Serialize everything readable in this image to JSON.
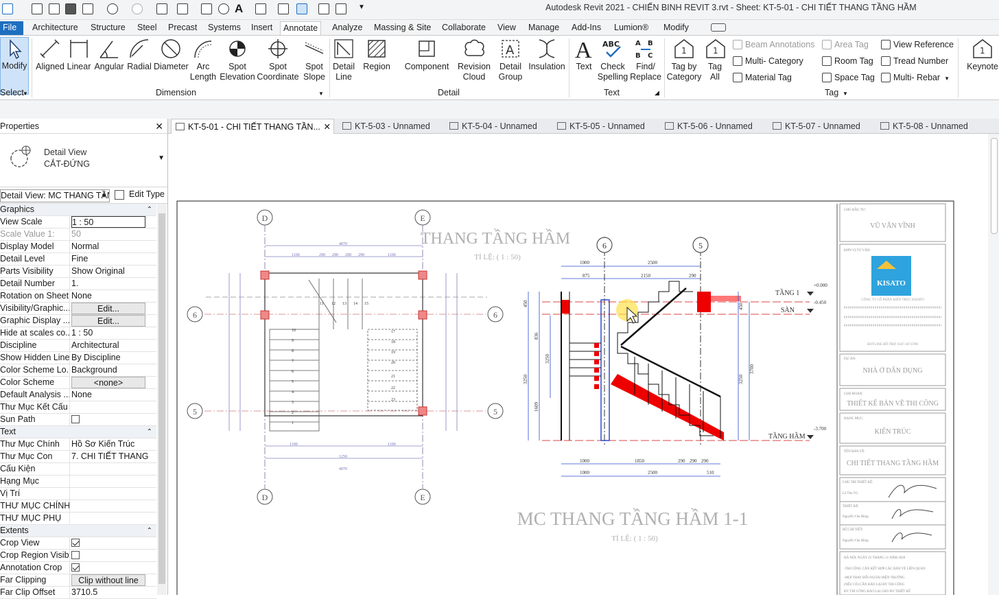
{
  "window": {
    "title": "Autodesk Revit 2021 - CHIẾN BINH REVIT 3.rvt - Sheet: KT-5-01 - CHI TIẾT THANG TẦNG HẦM"
  },
  "ribbon_tabs": [
    "File",
    "Architecture",
    "Structure",
    "Steel",
    "Precast",
    "Systems",
    "Insert",
    "Annotate",
    "Analyze",
    "Massing & Site",
    "Collaborate",
    "View",
    "Manage",
    "Add-Ins",
    "Lumion®",
    "Modify"
  ],
  "ribbon": {
    "modify": "Modify",
    "select": "Select",
    "dimension": {
      "label": "Dimension",
      "aligned": "Aligned",
      "linear": "Linear",
      "angular": "Angular",
      "radial": "Radial",
      "diameter": "Diameter",
      "arc1": "Arc",
      "arc2": "Length",
      "se1": "Spot",
      "se2": "Elevation",
      "sc1": "Spot",
      "sc2": "Coordinate",
      "ss1": "Spot",
      "ss2": "Slope"
    },
    "detail": {
      "label": "Detail",
      "dl1": "Detail",
      "dl2": "Line",
      "region": "Region",
      "component": "Component",
      "rc1": "Revision",
      "rc2": "Cloud",
      "dg1": "Detail",
      "dg2": "Group",
      "insulation": "Insulation"
    },
    "text": {
      "label": "Text",
      "text": "Text",
      "cs1": "Check",
      "cs2": "Spelling",
      "fr1": "Find/",
      "fr2": "Replace"
    },
    "tag": {
      "label": "Tag",
      "tc1": "Tag by",
      "tc2": "Category",
      "ta1": "Tag",
      "ta2": "All",
      "beam": "Beam Annotations",
      "multi_cat": "Multi- Category",
      "material": "Material Tag",
      "area": "Area Tag",
      "room": "Room Tag",
      "space": "Space Tag",
      "view_ref": "View Reference",
      "tread": "Tread Number",
      "multi_rebar": "Multi- Rebar"
    },
    "keynote": "Keynote"
  },
  "properties": {
    "title": "Properties",
    "type_line1": "Detail View",
    "type_line2": "CẮT-ĐỨNG",
    "instance": "Detail View: MC THANG TẦN",
    "edit_type": "Edit Type",
    "groups": {
      "graphics": "Graphics",
      "text": "Text",
      "extents": "Extents"
    },
    "rows": {
      "view_scale": [
        "View Scale",
        "1 : 50"
      ],
      "scale_value": [
        "Scale Value    1:",
        "50"
      ],
      "display_model": [
        "Display Model",
        "Normal"
      ],
      "detail_level": [
        "Detail Level",
        "Fine"
      ],
      "parts_visibility": [
        "Parts Visibility",
        "Show Original"
      ],
      "detail_number": [
        "Detail Number",
        "1."
      ],
      "rotation": [
        "Rotation on Sheet",
        "None"
      ],
      "visibility": [
        "Visibility/Graphic...",
        "Edit..."
      ],
      "graphic_display": [
        "Graphic Display ...",
        "Edit..."
      ],
      "hide_scales": [
        "Hide at scales co...",
        "1 : 50"
      ],
      "discipline": [
        "Discipline",
        "Architectural"
      ],
      "hidden_lines": [
        "Show Hidden Lines",
        "By Discipline"
      ],
      "color_loc": [
        "Color Scheme Lo...",
        "Background"
      ],
      "color_scheme": [
        "Color Scheme",
        "<none>"
      ],
      "default_analysis": [
        "Default Analysis ...",
        "None"
      ],
      "thu_muc_ket_cau": [
        "Thư Mục Kết Cấu",
        ""
      ],
      "sun_path": [
        "Sun Path",
        ""
      ],
      "thu_muc_chinh": [
        "Thư Mục Chính",
        "Hồ Sơ Kiến Trúc"
      ],
      "thu_muc_con": [
        "Thư Mục Con",
        "7. CHI TIẾT THANG"
      ],
      "cau_kien": [
        "Cấu Kiện",
        ""
      ],
      "hang_muc": [
        "Hạng Mục",
        ""
      ],
      "vi_tri": [
        "Vị Trí",
        ""
      ],
      "thu_muc_chinh_caps": [
        "THƯ MỤC CHÍNH",
        ""
      ],
      "thu_muc_phu": [
        "THƯ MỤC PHỤ",
        ""
      ],
      "crop_view": [
        "Crop View",
        ""
      ],
      "crop_region": [
        "Crop Region Visible",
        ""
      ],
      "annotation_crop": [
        "Annotation Crop",
        ""
      ],
      "far_clipping": [
        "Far Clipping",
        "Clip without line"
      ],
      "far_clip_offset": [
        "Far Clip Offset",
        "3710.5"
      ]
    }
  },
  "doc_tabs": [
    "KT-5-01 - CHI TIẾT THANG TẦN...",
    "KT-5-03 - Unnamed",
    "KT-5-04 - Unnamed",
    "KT-5-05 - Unnamed",
    "KT-5-06 - Unnamed",
    "KT-5-07 - Unnamed",
    "KT-5-08 - Unnamed"
  ],
  "drawing": {
    "plan_title": "THANG TẦNG HẦM",
    "plan_scale": "TỈ LỆ: ( 1 : 50)",
    "section_title": "MC THANG TẦNG HẦM 1-1",
    "section_scale": "TỈ LỆ: ( 1 : 50)",
    "grid_d": "D",
    "grid_e": "E",
    "grid_6": "6",
    "grid_5": "5",
    "level_t1": "TẦNG 1",
    "level_san": "SÀN",
    "level_ham": "TẦNG HẦM",
    "elev_0": "+0.000",
    "elev_045": "-0.450",
    "elev_37": "-3.700",
    "dims_top": [
      "1000",
      "2500",
      "875",
      "2150",
      "290"
    ],
    "dims_bottom1": [
      "1000",
      "1850",
      "290",
      "290",
      "290"
    ],
    "dims_bottom2": [
      "1000",
      "2500",
      "510"
    ],
    "dims_left": [
      "450",
      "3250",
      "1609",
      "836",
      "3250"
    ],
    "dims_right": [
      "450",
      "3700",
      "3250"
    ],
    "plan_dims_top": [
      "4070",
      "1100",
      "290",
      "290",
      "290",
      "290",
      "1100"
    ],
    "plan_dims_bottom": [
      "1100",
      "1250",
      "1100",
      "4070"
    ],
    "plan_steps_left": [
      "10",
      "9",
      "8",
      "7",
      "6",
      "5",
      "4",
      "3",
      "2",
      "1"
    ],
    "plan_steps_right": [
      "17",
      "18",
      "19",
      "20",
      "21",
      "22",
      "23"
    ],
    "plan_steps_top": [
      "11",
      "12",
      "13",
      "14",
      "15"
    ]
  },
  "titleblock": {
    "owner_label": "CHỦ ĐẦU TƯ:",
    "owner": "VŨ VĂN VĨNH",
    "consultant_label": "ĐƠN VỊ TƯ VẤN:",
    "logo": "KISATO",
    "company": "CÔNG TY CỔ PHẦN KIẾN TRÚC KISATO",
    "hotline": "HOTLINE HỖ TRỢ: 0247.107.6789",
    "project_label": "DỰ ÁN:",
    "project": "NHÀ Ở DÂN DỤNG",
    "phase_label": "GIAI ĐOẠN:",
    "phase": "THIẾT KẾ BẢN VẼ THI CÔNG",
    "item_label": "HẠNG MỤC:",
    "item": "KIẾN TRÚC",
    "sheet_label": "TÊN BẢN VẼ:",
    "sheet": "CHI TIẾT THANG TẦNG HẦM",
    "designer_label": "CHỦ TRÌ THIẾT KẾ:",
    "designer": "Lê Thu Vũ",
    "drawer_label": "THIẾT KẾ:",
    "drawer": "Nguyễn Văn Hùng",
    "checker_label": "BỘ CHỈ TIẾT:",
    "checker": "Nguyễn Văn Hùng",
    "date": "HÀ NỘI, NGÀY 25 THÁNG 11 NĂM 2020",
    "note1": "-THI CÔNG CĂN KẾT HỢP CÁC BẢN VẼ LIÊN QUAN",
    "note2": "-MỌI THAY ĐỔI NGOÀI HIỆN TRƯỜNG",
    "note3": "(NẾU CÓ) CẦN BÁO LẠI ĐV THI CÔNG",
    "note4": "ĐV THI CÔNG BÁO LẠI CHO ĐV THIẾT KẾ"
  }
}
